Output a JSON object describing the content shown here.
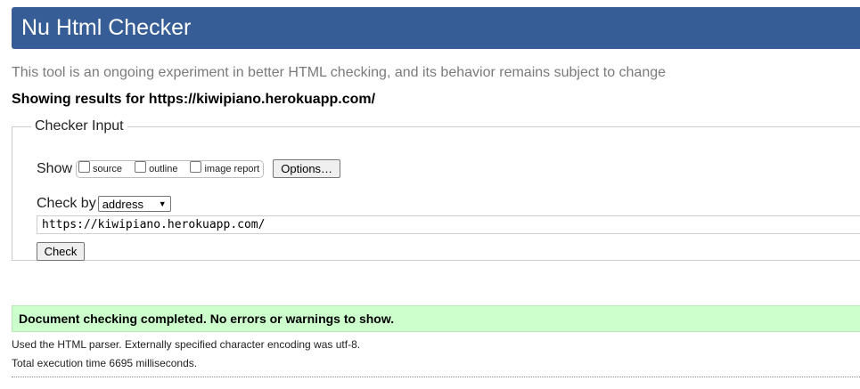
{
  "header": {
    "title": "Nu Html Checker"
  },
  "intro_text": "This tool is an ongoing experiment in better HTML checking, and its behavior remains subject to change",
  "showing_results": "Showing results for https://kiwipiano.herokuapp.com/",
  "checker_input": {
    "legend": "Checker Input",
    "show_label": "Show",
    "options": [
      {
        "label": "source",
        "checked": false
      },
      {
        "label": "outline",
        "checked": false
      },
      {
        "label": "image report",
        "checked": false
      }
    ],
    "options_button": "Options…",
    "check_by_label": "Check by",
    "check_by_selected": "address",
    "url_value": "https://kiwipiano.herokuapp.com/",
    "check_button": "Check"
  },
  "result": {
    "success_message": "Document checking completed. No errors or warnings to show.",
    "parser_note": "Used the HTML parser. Externally specified character encoding was utf-8.",
    "execution_time": "Total execution time 6695 milliseconds."
  },
  "colors": {
    "header_bg": "#365d95",
    "success_bg": "#ccffcc"
  }
}
